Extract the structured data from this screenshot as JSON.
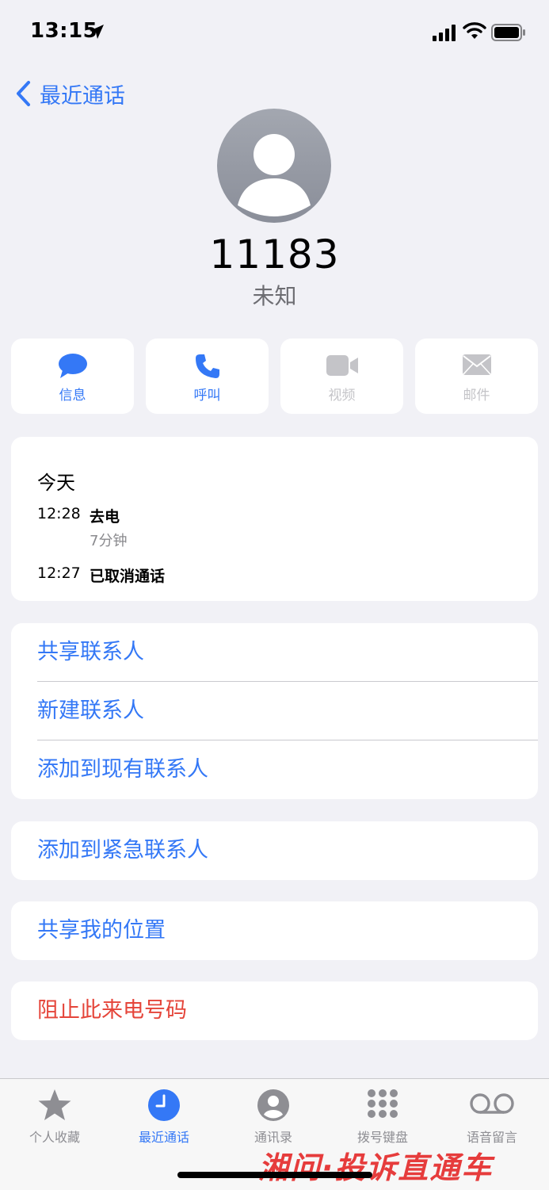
{
  "status_bar": {
    "time": "13:15"
  },
  "nav": {
    "back_label": "最近通话"
  },
  "contact": {
    "number": "11183",
    "label": "未知"
  },
  "actions": [
    {
      "label": "信息",
      "icon": "message-icon",
      "enabled": true
    },
    {
      "label": "呼叫",
      "icon": "phone-icon",
      "enabled": true
    },
    {
      "label": "视频",
      "icon": "video-icon",
      "enabled": false
    },
    {
      "label": "邮件",
      "icon": "mail-icon",
      "enabled": false
    }
  ],
  "history": {
    "day": "今天",
    "entries": [
      {
        "time": "12:28",
        "type": "去电",
        "duration": "7分钟"
      },
      {
        "time": "12:27",
        "type": "已取消通话"
      }
    ]
  },
  "options": {
    "share_contact": "共享联系人",
    "new_contact": "新建联系人",
    "add_existing": "添加到现有联系人",
    "add_emergency": "添加到紧急联系人",
    "share_location": "共享我的位置",
    "block": "阻止此来电号码"
  },
  "tabs": [
    {
      "label": "个人收藏",
      "icon": "star-icon",
      "active": false
    },
    {
      "label": "最近通话",
      "icon": "clock-icon",
      "active": true
    },
    {
      "label": "通讯录",
      "icon": "person-circle-icon",
      "active": false
    },
    {
      "label": "拨号键盘",
      "icon": "keypad-icon",
      "active": false
    },
    {
      "label": "语音留言",
      "icon": "voicemail-icon",
      "active": false
    }
  ],
  "watermark": "湘问·投诉直通车",
  "colors": {
    "accent": "#3478f6",
    "destructive": "#e5453a",
    "background": "#f1f1f6"
  }
}
